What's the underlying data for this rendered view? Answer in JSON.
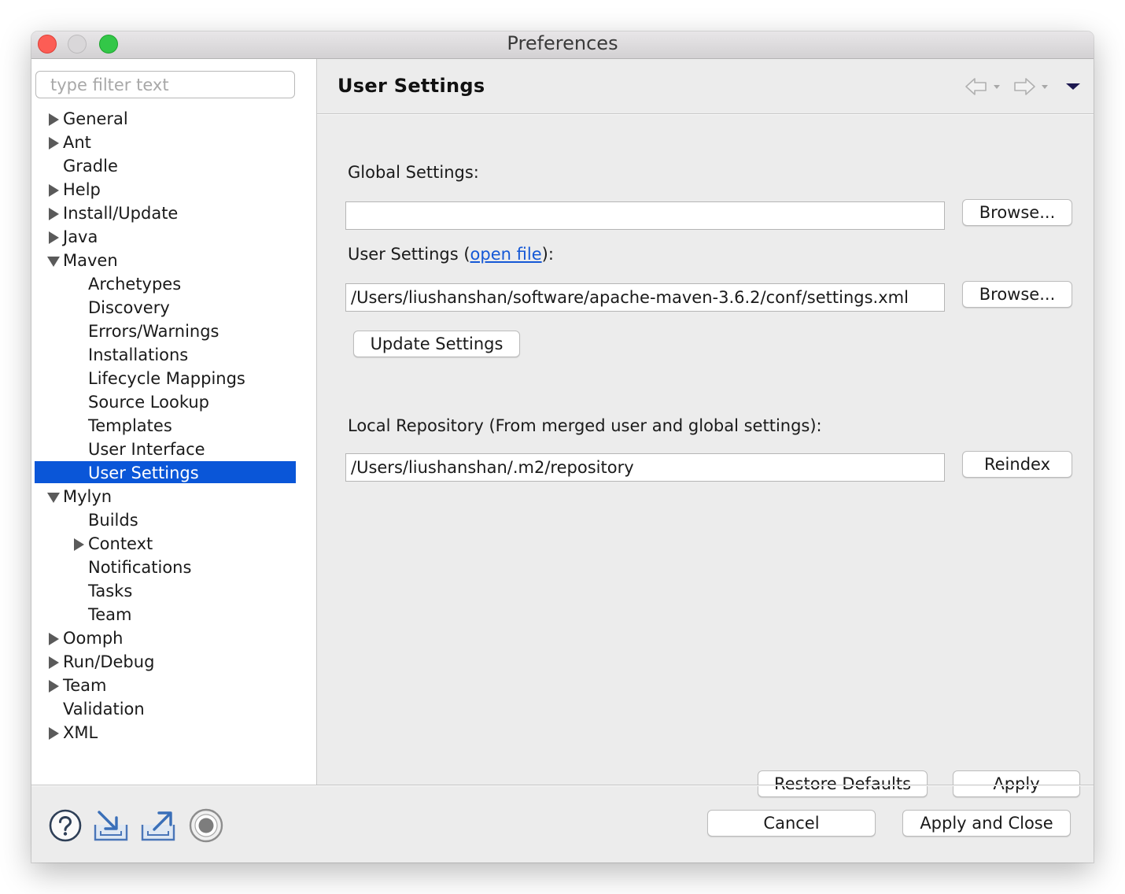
{
  "window": {
    "title": "Preferences"
  },
  "filter": {
    "placeholder": "type filter text",
    "value": ""
  },
  "tree": [
    {
      "label": "General",
      "level": 0,
      "arrow": "right"
    },
    {
      "label": "Ant",
      "level": 0,
      "arrow": "right"
    },
    {
      "label": "Gradle",
      "level": 0,
      "arrow": "none"
    },
    {
      "label": "Help",
      "level": 0,
      "arrow": "right"
    },
    {
      "label": "Install/Update",
      "level": 0,
      "arrow": "right"
    },
    {
      "label": "Java",
      "level": 0,
      "arrow": "right"
    },
    {
      "label": "Maven",
      "level": 0,
      "arrow": "down"
    },
    {
      "label": "Archetypes",
      "level": 1,
      "arrow": "none"
    },
    {
      "label": "Discovery",
      "level": 1,
      "arrow": "none"
    },
    {
      "label": "Errors/Warnings",
      "level": 1,
      "arrow": "none"
    },
    {
      "label": "Installations",
      "level": 1,
      "arrow": "none"
    },
    {
      "label": "Lifecycle Mappings",
      "level": 1,
      "arrow": "none"
    },
    {
      "label": "Source Lookup",
      "level": 1,
      "arrow": "none"
    },
    {
      "label": "Templates",
      "level": 1,
      "arrow": "none"
    },
    {
      "label": "User Interface",
      "level": 1,
      "arrow": "none"
    },
    {
      "label": "User Settings",
      "level": 1,
      "arrow": "none",
      "selected": true
    },
    {
      "label": "Mylyn",
      "level": 0,
      "arrow": "down"
    },
    {
      "label": "Builds",
      "level": 1,
      "arrow": "none"
    },
    {
      "label": "Context",
      "level": 1,
      "arrow": "right"
    },
    {
      "label": "Notifications",
      "level": 1,
      "arrow": "none"
    },
    {
      "label": "Tasks",
      "level": 1,
      "arrow": "none"
    },
    {
      "label": "Team",
      "level": 1,
      "arrow": "none"
    },
    {
      "label": "Oomph",
      "level": 0,
      "arrow": "right"
    },
    {
      "label": "Run/Debug",
      "level": 0,
      "arrow": "right"
    },
    {
      "label": "Team",
      "level": 0,
      "arrow": "right"
    },
    {
      "label": "Validation",
      "level": 0,
      "arrow": "none"
    },
    {
      "label": "XML",
      "level": 0,
      "arrow": "right"
    }
  ],
  "page": {
    "title": "User Settings",
    "global_label": "Global Settings:",
    "global_value": "",
    "browse_label": "Browse...",
    "user_label_prefix": "User Settings (",
    "user_label_link": "open file",
    "user_label_suffix": "):",
    "user_value": "/Users/liushanshan/software/apache-maven-3.6.2/conf/settings.xml",
    "update_label": "Update Settings",
    "local_label": "Local Repository (From merged user and global settings):",
    "local_value": "/Users/liushanshan/.m2/repository",
    "reindex_label": "Reindex",
    "restore_label": "Restore Defaults",
    "apply_label": "Apply"
  },
  "footer": {
    "cancel_label": "Cancel",
    "apply_close_label": "Apply and Close"
  },
  "colors": {
    "selection": "#0a56d8",
    "link": "#1558d6",
    "close": "#fc5d55",
    "maximize": "#33c748"
  }
}
